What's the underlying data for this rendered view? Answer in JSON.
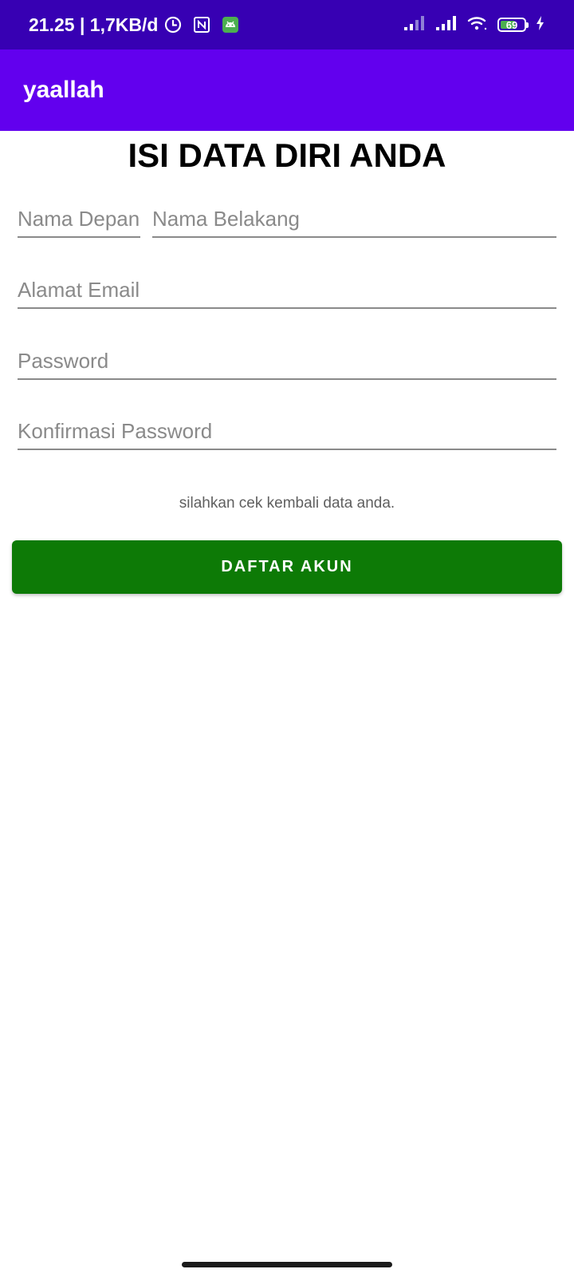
{
  "status_bar": {
    "time": "21.25",
    "net_speed": "1,7KB/d",
    "battery_level": "69",
    "battery_percent": 69,
    "bg_color": "#3700b3",
    "icons": [
      "clock-icon",
      "nfc-icon",
      "android-notification-icon",
      "signal-icon",
      "signal-icon",
      "wifi-icon",
      "battery-icon",
      "charging-icon"
    ]
  },
  "app_bar": {
    "title": "yaallah",
    "bg_color": "#6200ee"
  },
  "form": {
    "heading": "ISI DATA DIRI ANDA",
    "first_name_placeholder": "Nama Depan",
    "last_name_placeholder": "Nama Belakang",
    "email_placeholder": "Alamat Email",
    "password_placeholder": "Password",
    "confirm_password_placeholder": "Konfirmasi Password",
    "hint": "silahkan cek kembali data anda.",
    "submit_label": "DAFTAR AKUN",
    "submit_color": "#0d7a06"
  }
}
